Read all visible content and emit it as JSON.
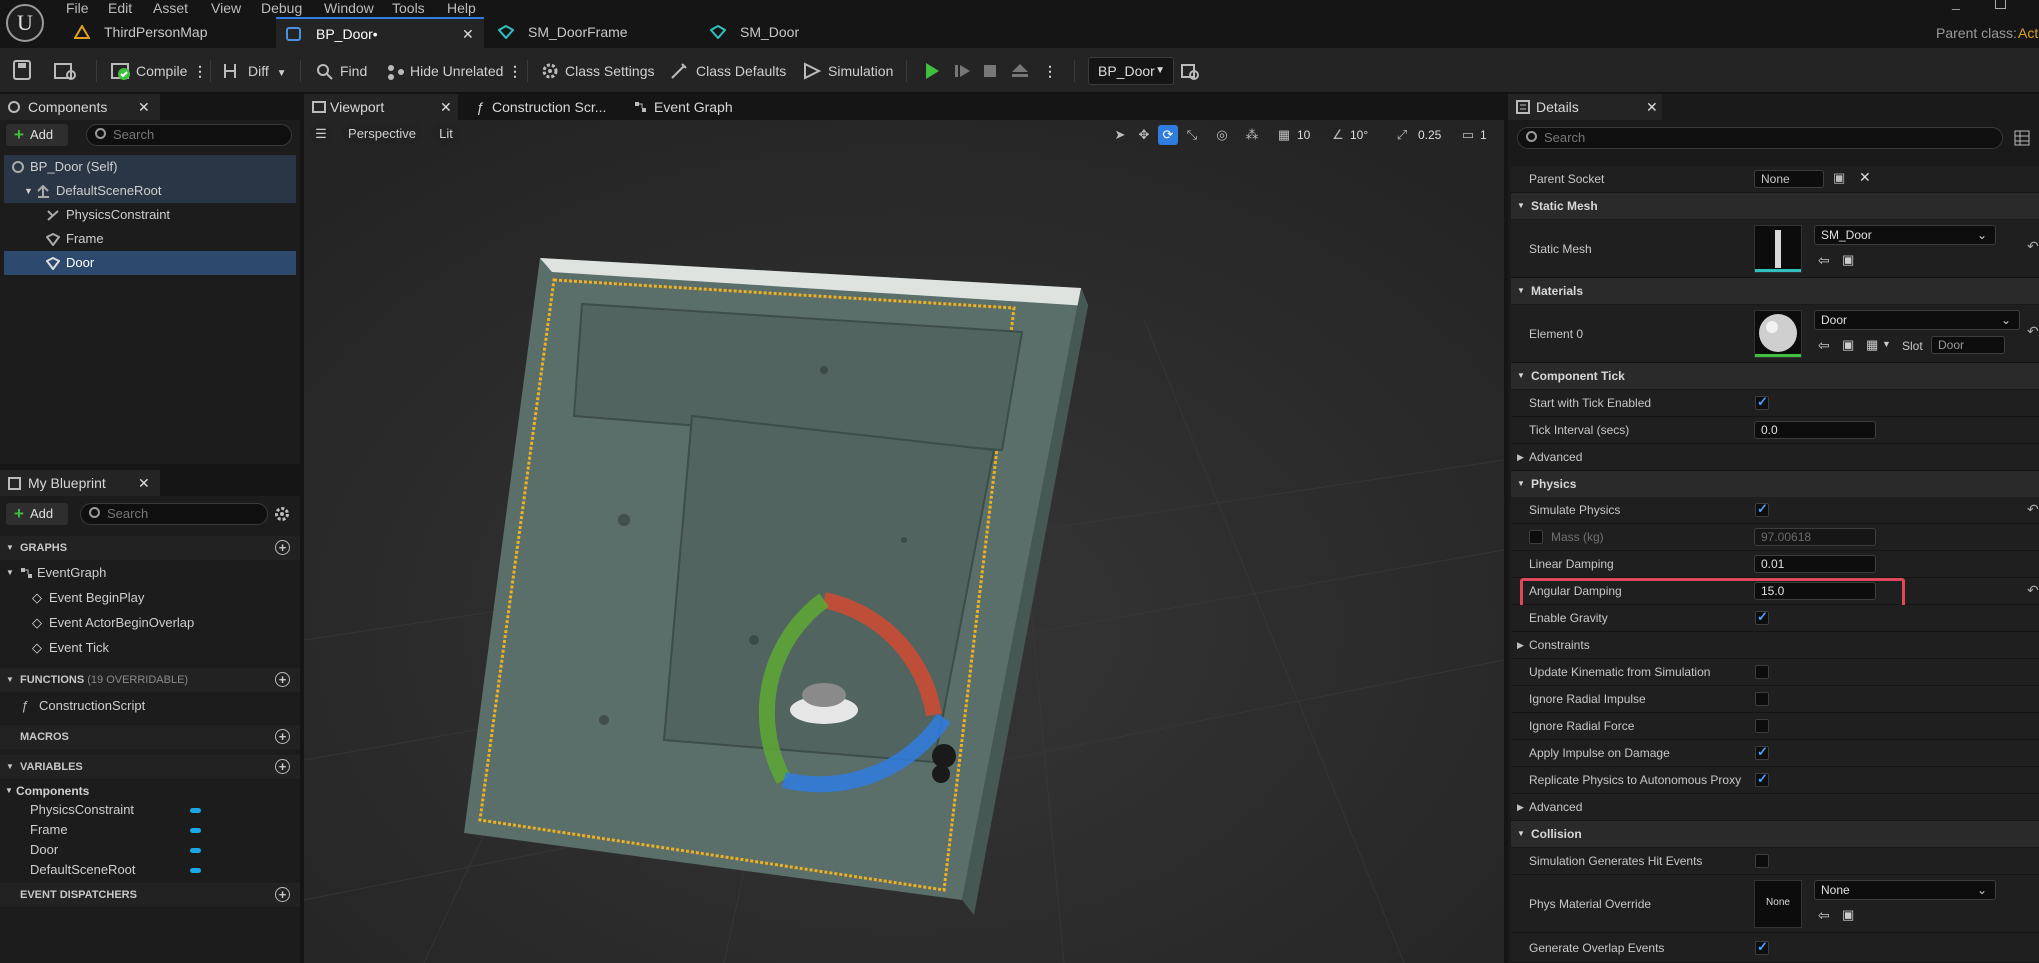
{
  "menu": [
    "File",
    "Edit",
    "Asset",
    "View",
    "Debug",
    "Window",
    "Tools",
    "Help"
  ],
  "doc_tabs": [
    {
      "label": "ThirdPersonMap"
    },
    {
      "label": "BP_Door•"
    },
    {
      "label": "SM_DoorFrame"
    },
    {
      "label": "SM_Door"
    }
  ],
  "parent_class_label": "Parent class:",
  "parent_class_value": "Acto",
  "toolbar": {
    "compile": "Compile",
    "diff": "Diff",
    "find": "Find",
    "hide_unrelated": "Hide Unrelated",
    "class_settings": "Class Settings",
    "class_defaults": "Class Defaults",
    "simulation": "Simulation",
    "debug_object": "BP_Door"
  },
  "components_panel": {
    "tab": "Components",
    "add": "Add",
    "search_placeholder": "Search",
    "items": [
      "BP_Door (Self)",
      "DefaultSceneRoot",
      "PhysicsConstraint",
      "Frame",
      "Door"
    ]
  },
  "my_blueprint": {
    "tab": "My Blueprint",
    "add": "Add",
    "search_placeholder": "Search",
    "graphs_header": "GRAPHS",
    "graphs": [
      "EventGraph",
      "Event BeginPlay",
      "Event ActorBeginOverlap",
      "Event Tick"
    ],
    "functions_header": "FUNCTIONS",
    "functions_count": "(19 OVERRIDABLE)",
    "functions": [
      "ConstructionScript"
    ],
    "macros_header": "MACROS",
    "variables_header": "VARIABLES",
    "variables_group": "Components",
    "variables": [
      "PhysicsConstraint",
      "Frame",
      "Door",
      "DefaultSceneRoot"
    ],
    "dispatchers_header": "EVENT DISPATCHERS"
  },
  "center_tabs": [
    "Viewport",
    "Construction Scr...",
    "Event Graph"
  ],
  "viewport": {
    "perspective": "Perspective",
    "lit": "Lit",
    "grid_snap": "10",
    "rot_snap": "10°",
    "scale_snap": "0.25",
    "camera_speed": "1"
  },
  "details": {
    "tab": "Details",
    "search_placeholder": "Search",
    "parent_socket_label": "Parent Socket",
    "parent_socket_value": "None",
    "cat_static_mesh": "Static Mesh",
    "static_mesh_label": "Static Mesh",
    "static_mesh_value": "SM_Door",
    "cat_materials": "Materials",
    "element0_label": "Element 0",
    "element0_value": "Door",
    "slot_label": "Slot",
    "slot_value": "Door",
    "cat_component_tick": "Component Tick",
    "start_tick_label": "Start with Tick Enabled",
    "tick_interval_label": "Tick Interval (secs)",
    "tick_interval_value": "0.0",
    "advanced": "Advanced",
    "cat_physics": "Physics",
    "simulate_physics_label": "Simulate Physics",
    "mass_label": "Mass (kg)",
    "mass_value": "97.00618",
    "linear_damping_label": "Linear Damping",
    "linear_damping_value": "0.01",
    "angular_damping_label": "Angular Damping",
    "angular_damping_value": "15.0",
    "enable_gravity_label": "Enable Gravity",
    "constraints_label": "Constraints",
    "update_kinematic_label": "Update Kinematic from Simulation",
    "ignore_radial_impulse_label": "Ignore Radial Impulse",
    "ignore_radial_force_label": "Ignore Radial Force",
    "apply_impulse_label": "Apply Impulse on Damage",
    "replicate_physics_label": "Replicate Physics to Autonomous Proxy",
    "advanced2": "Advanced",
    "cat_collision": "Collision",
    "sim_hit_events_label": "Simulation Generates Hit Events",
    "phys_material_label": "Phys Material Override",
    "phys_material_value": "None",
    "phys_material_thumb": "None",
    "overlap_events_label": "Generate Overlap Events"
  },
  "colors": {
    "accent": "#2f7de0",
    "highlight_box": "#e0485a",
    "selection": "#2d4a6e",
    "play_green": "#3fbf3f"
  }
}
